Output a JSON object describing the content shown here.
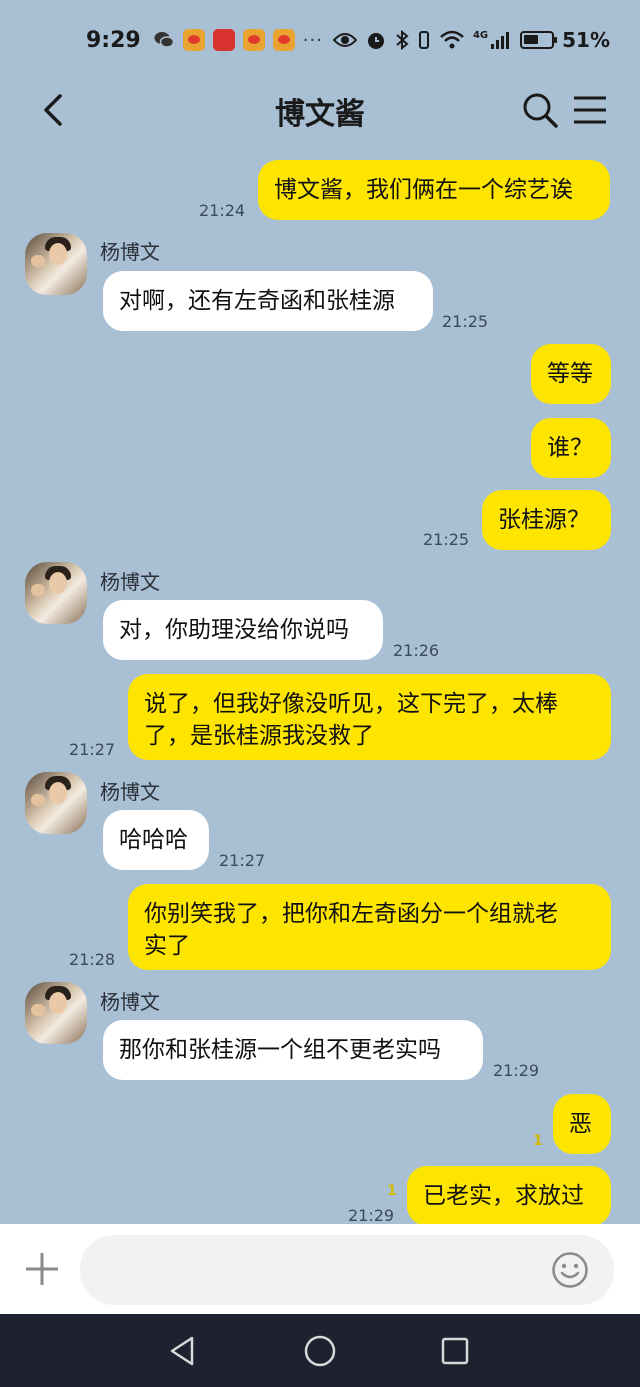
{
  "status_bar": {
    "time": "9:29",
    "dots": "···",
    "network": "4G",
    "battery": "51%"
  },
  "header": {
    "title": "博文酱"
  },
  "messages": [
    {
      "side": "me",
      "text": "博文酱，我们俩在一个综艺诶",
      "time": "21:24"
    },
    {
      "side": "other",
      "sender": "杨博文",
      "text": "对啊，还有左奇函和张桂源",
      "time": "21:25"
    },
    {
      "side": "me",
      "text": "等等"
    },
    {
      "side": "me",
      "text": "谁？"
    },
    {
      "side": "me",
      "text": "张桂源？",
      "time": "21:25"
    },
    {
      "side": "other",
      "sender": "杨博文",
      "text": "对，你助理没给你说吗",
      "time": "21:26"
    },
    {
      "side": "me",
      "lines": [
        "说了，但我好像没听见，这下完了，太棒",
        "了，是张桂源我没救了"
      ],
      "time": "21:27"
    },
    {
      "side": "other",
      "sender": "杨博文",
      "text": "哈哈哈",
      "time": "21:27"
    },
    {
      "side": "me",
      "lines": [
        "你别笑我了，把你和左奇函分一个组就老",
        "实了"
      ],
      "time": "21:28"
    },
    {
      "side": "other",
      "sender": "杨博文",
      "text": "那你和张桂源一个组不更老实吗",
      "time": "21:29"
    },
    {
      "side": "me",
      "text": "恶",
      "unread": "1"
    },
    {
      "side": "me",
      "text": "已老实，求放过",
      "unread": "1",
      "time": "21:29"
    }
  ],
  "input": {
    "placeholder": ""
  },
  "icons": {
    "back": "chevron-left-icon",
    "search": "search-icon",
    "menu": "menu-icon",
    "plus": "plus-icon",
    "emoji": "emoji-icon"
  },
  "colors": {
    "background": "#a9bfd3",
    "my_bubble": "#fee500",
    "other_bubble": "#ffffff"
  }
}
